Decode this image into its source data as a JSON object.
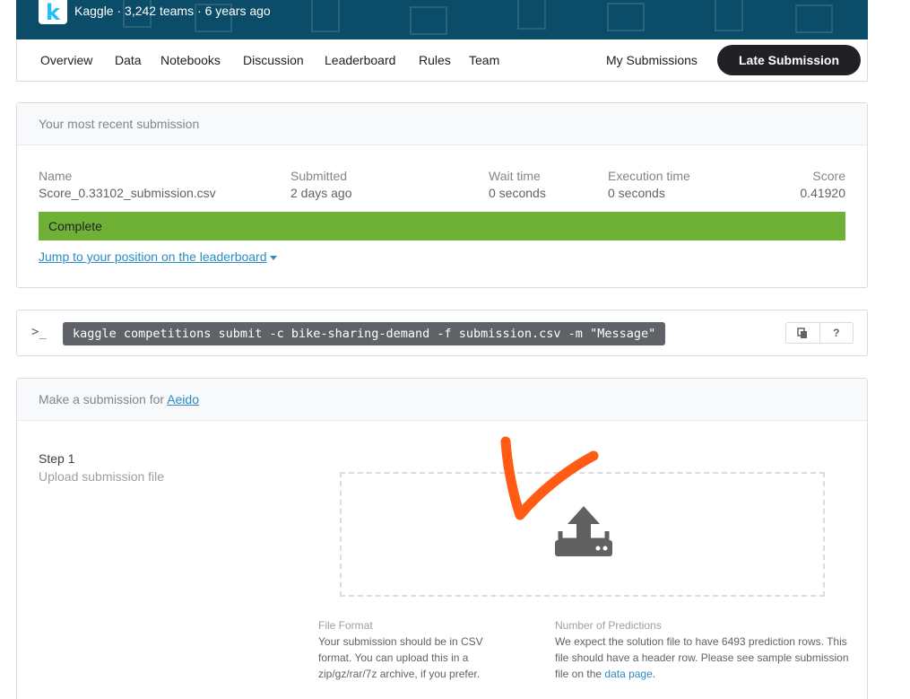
{
  "header": {
    "brand": "Kaggle",
    "teams": "3,242 teams",
    "age": "6 years ago",
    "separator": "·"
  },
  "nav": {
    "tabs": [
      "Overview",
      "Data",
      "Notebooks",
      "Discussion",
      "Leaderboard",
      "Rules",
      "Team"
    ],
    "my_submissions": "My Submissions",
    "late_submission": "Late Submission"
  },
  "recent": {
    "heading": "Your most recent submission",
    "columns": [
      {
        "label": "Name",
        "value": "Score_0.33102_submission.csv"
      },
      {
        "label": "Submitted",
        "value": "2 days ago"
      },
      {
        "label": "Wait time",
        "value": "0 seconds"
      },
      {
        "label": "Execution time",
        "value": "0 seconds"
      },
      {
        "label": "Score",
        "value": "0.41920"
      }
    ],
    "status": "Complete",
    "status_color": "#6fb137",
    "jump_link": "Jump to your position on the leaderboard"
  },
  "cli": {
    "prompt": ">_",
    "command": "kaggle competitions submit -c bike-sharing-demand -f submission.csv -m \"Message\"",
    "copy_icon": "copy-icon",
    "help_label": "?"
  },
  "submission": {
    "heading_prefix": "Make a submission for",
    "owner": "Aeido",
    "step_title": "Step 1",
    "step_subtitle": "Upload submission file",
    "upload_icon": "upload-icon",
    "file_format_title": "File Format",
    "file_format_text": "Your submission should be in CSV format. You can upload this in a zip/gz/rar/7z archive, if you prefer.",
    "predictions_title": "Number of Predictions",
    "predictions_text_a": "We expect the solution file to have 6493 prediction rows. This file should have a header row. Please see sample submission file on the",
    "predictions_link": "data page",
    "predictions_text_b": "."
  },
  "colors": {
    "banner": "#0b4c68",
    "accent": "#2a8bc3",
    "annotation": "#ff5b14"
  }
}
